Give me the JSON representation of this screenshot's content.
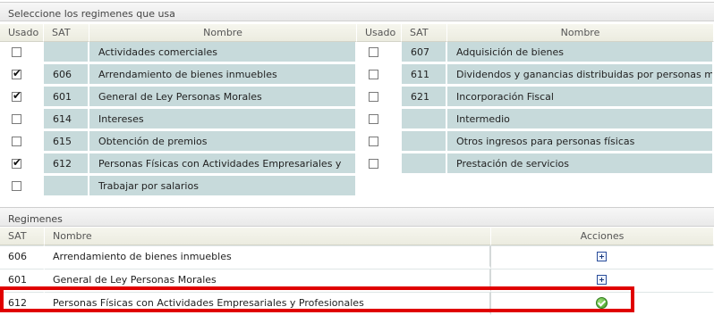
{
  "select_section": {
    "title": "Seleccione los regimenes que usa"
  },
  "select_table": {
    "headers": {
      "usado": "Usado",
      "sat": "SAT",
      "nombre": "Nombre"
    },
    "left_rows": [
      {
        "checked": false,
        "sat": "",
        "nombre": "Actividades comerciales"
      },
      {
        "checked": true,
        "sat": "606",
        "nombre": "Arrendamiento de bienes inmuebles"
      },
      {
        "checked": true,
        "sat": "601",
        "nombre": "General de Ley Personas Morales"
      },
      {
        "checked": false,
        "sat": "614",
        "nombre": "Intereses"
      },
      {
        "checked": false,
        "sat": "615",
        "nombre": "Obtención de premios"
      },
      {
        "checked": true,
        "sat": "612",
        "nombre": "Personas Físicas con Actividades Empresariales y"
      },
      {
        "checked": false,
        "sat": "",
        "nombre": "Trabajar por salarios"
      }
    ],
    "right_rows": [
      {
        "checked": false,
        "sat": "607",
        "nombre": "Adquisición de bienes"
      },
      {
        "checked": false,
        "sat": "611",
        "nombre": "Dividendos y ganancias distribuidas por personas morales"
      },
      {
        "checked": false,
        "sat": "621",
        "nombre": "Incorporación Fiscal"
      },
      {
        "checked": false,
        "sat": "",
        "nombre": "Intermedio"
      },
      {
        "checked": false,
        "sat": "",
        "nombre": "Otros ingresos para personas físicas"
      },
      {
        "checked": false,
        "sat": "",
        "nombre": "Prestación de servicios"
      }
    ]
  },
  "reg_section": {
    "title": "Regimenes"
  },
  "reg_table": {
    "headers": {
      "sat": "SAT",
      "nombre": "Nombre",
      "acciones": "Acciones"
    },
    "rows": [
      {
        "sat": "606",
        "nombre": "Arrendamiento de bienes inmuebles",
        "action_icon": "plus-icon"
      },
      {
        "sat": "601",
        "nombre": "General de Ley Personas Morales",
        "action_icon": "plus-icon"
      },
      {
        "sat": "612",
        "nombre": "Personas Físicas con Actividades Empresariales y Profesionales",
        "action_icon": "check-icon"
      }
    ]
  },
  "colors": {
    "row_bg": "#c7dadb",
    "highlight": "#e00000"
  }
}
